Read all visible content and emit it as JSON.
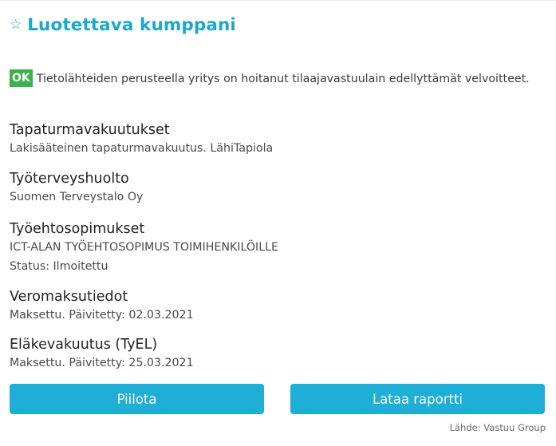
{
  "header": {
    "icon": "star-icon",
    "title": "Luotettava kumppani",
    "accent_color": "#1aa8cf"
  },
  "status": {
    "badge": "OK",
    "badge_color": "#3bb14a",
    "text": "Tietolähteiden perusteella yritys on hoitanut tilaajavastuulain edellyttämät velvoitteet."
  },
  "sections": [
    {
      "title": "Tapaturmavakuutukset",
      "lines": [
        "Lakisääteinen tapaturmavakuutus. LähiTapiola"
      ]
    },
    {
      "title": "Työterveyshuolto",
      "lines": [
        "Suomen Terveystalo Oy"
      ]
    },
    {
      "title": "Työehtosopimukset",
      "lines": [
        "ICT-ALAN TYÖEHTOSOPIMUS TOIMIHENKILÖILLE",
        "Status: Ilmoitettu"
      ]
    },
    {
      "title": "Veromaksutiedot",
      "lines": [
        "Maksettu. Päivitetty: 02.03.2021"
      ]
    },
    {
      "title": "Eläkevakuutus (TyEL)",
      "lines": [
        "Maksettu. Päivitetty: 25.03.2021"
      ]
    }
  ],
  "buttons": {
    "hide_label": "Piilota",
    "download_label": "Lataa raportti",
    "color": "#1eaed6"
  },
  "source": "Lähde: Vastuu Group"
}
